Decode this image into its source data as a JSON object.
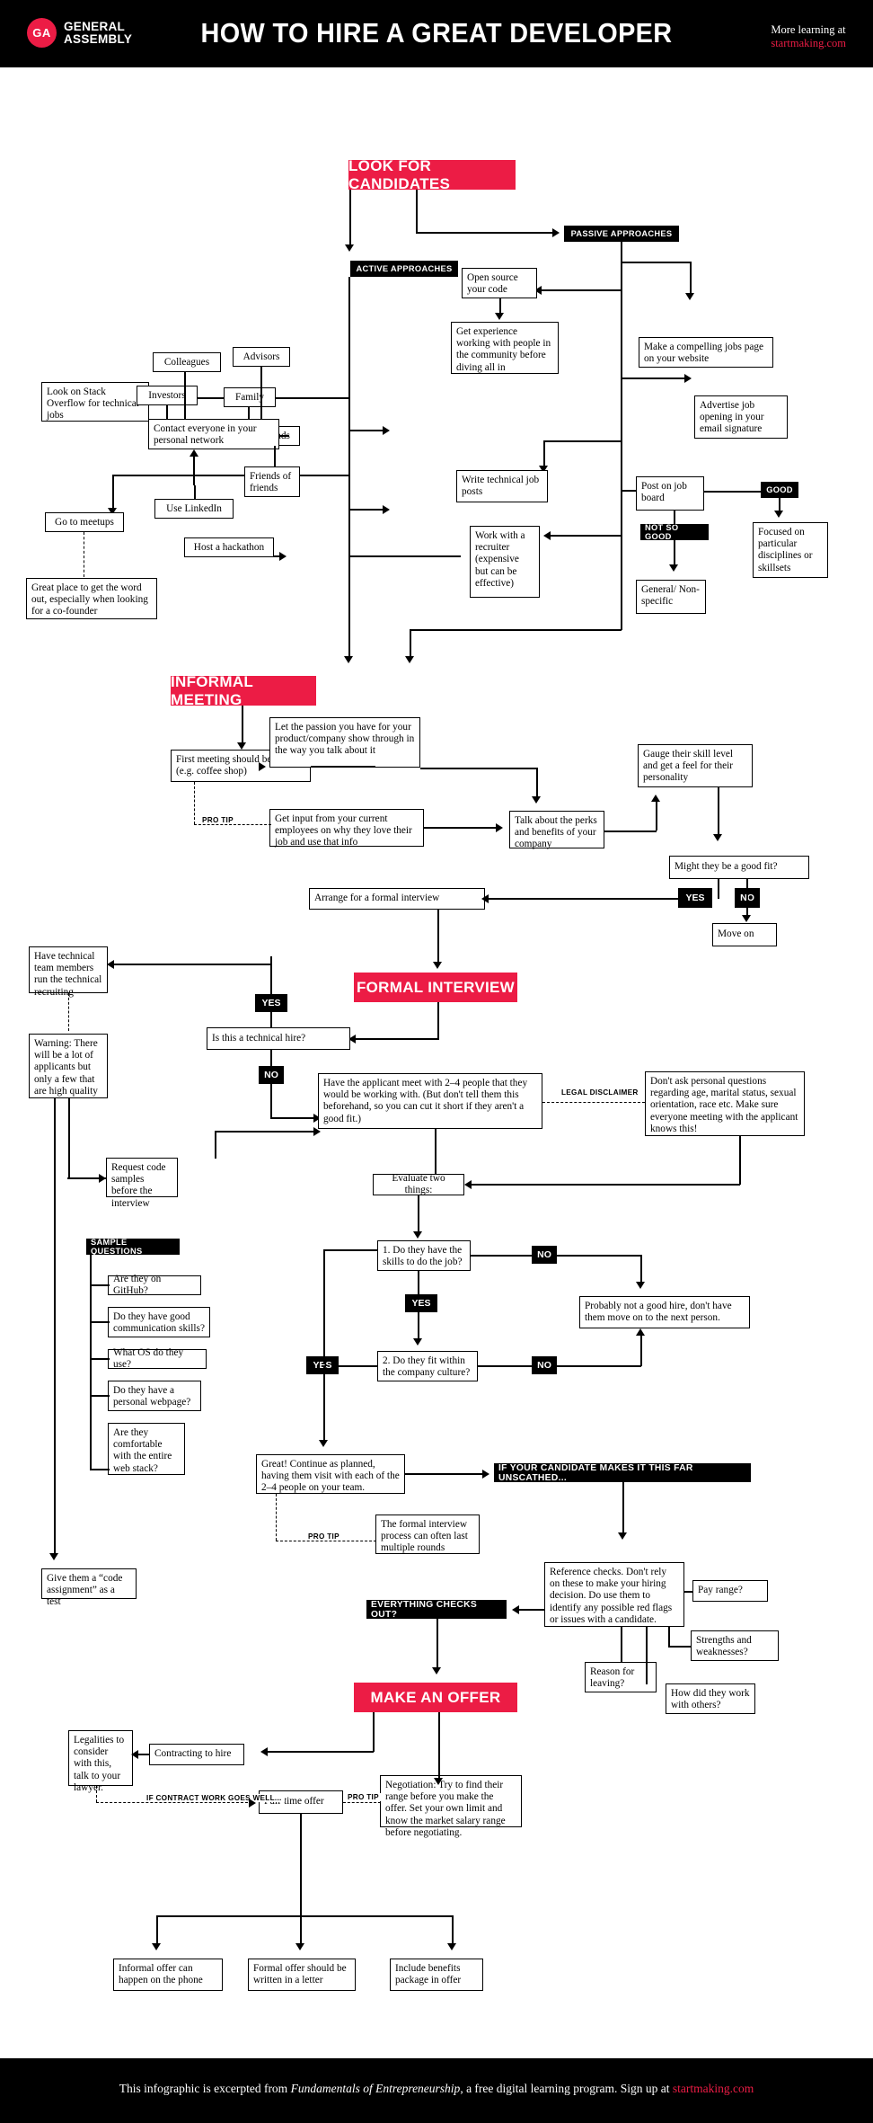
{
  "header": {
    "logo_initials": "GA",
    "logo_line1": "GENERAL",
    "logo_line2": "ASSEMBLY",
    "title": "HOW TO HIRE A GREAT DEVELOPER",
    "more_learning_label": "More learning at",
    "more_learning_url": "startmaking.com",
    "brand_red": "#ec1c45"
  },
  "footer": {
    "text_before": "This infographic is excerpted from ",
    "italic": "Fundamentals of Entrepreneurship",
    "text_after": ", a free digital learning program. Sign up at ",
    "url": "startmaking.com"
  },
  "stages": {
    "look_for_candidates": "LOOK FOR CANDIDATES",
    "informal_meeting": "INFORMAL MEETING",
    "formal_interview": "FORMAL INTERVIEW",
    "make_an_offer": "MAKE AN OFFER"
  },
  "section1": {
    "active_approaches": "ACTIVE APPROACHES",
    "passive_approaches": "PASSIVE APPROACHES",
    "stack_overflow": "Look on Stack Overflow for technical jobs",
    "colleagues": "Colleagues",
    "investors": "Investors",
    "advisors": "Advisors",
    "family": "Family",
    "friends": "Friends",
    "friends_of_friends": "Friends of friends",
    "contact_network": "Contact everyone in your personal network",
    "use_linkedin": "Use LinkedIn",
    "go_to_meetups": "Go to meetups",
    "meetups_note": "Great place to get the word out, especially when looking for a co-founder",
    "host_hackathon": "Host a hackathon",
    "open_source": "Open source your code",
    "get_experience": "Get experience working with people in the community before diving all in",
    "write_job_posts": "Write technical job posts",
    "work_with_recruiter": "Work with a recruiter (expensive but can be effective)",
    "jobs_page": "Make a compelling jobs page on your website",
    "email_signature": "Advertise job opening in your email signature",
    "post_job_board": "Post on job board",
    "good": "GOOD",
    "not_so_good": "NOT SO GOOD",
    "focused": "Focused on particular disciplines or skillsets",
    "general": "General/ Non-specific"
  },
  "section2": {
    "first_meeting": "First meeting should be casual (e.g. coffee shop)",
    "pro_tip": "PRO TIP",
    "get_input": "Get input from your current employees on why they love their job and use that info",
    "passion": "Let the passion you have for your product/company show through in the way you talk about it",
    "perks": "Talk about the perks and benefits of your company",
    "gauge_skill": "Gauge their skill level and get a feel for their personality",
    "good_fit": "Might they be a good fit?",
    "yes": "YES",
    "no": "NO",
    "arrange_interview": "Arrange for a formal interview",
    "move_on": "Move on"
  },
  "section3": {
    "technical_hire": "Is this a technical hire?",
    "yes": "YES",
    "no": "NO",
    "tech_team": "Have technical team members run the  technical recruiting",
    "warning": "Warning: There will be a lot of applicants but only a few that are high quality",
    "request_code": "Request code samples before the interview",
    "code_assignment": "Give them a “code assignment” as a test",
    "applicant_meet": "Have the applicant meet with 2–4 people that they would be working with. (But don't tell them this beforehand, so you can cut it short if they aren't a good fit.)",
    "legal_disclaimer_label": "LEGAL DISCLAIMER",
    "legal_disclaimer": "Don't ask personal questions regarding age, marital status, sexual orientation, race etc. Make sure everyone meeting with the applicant knows this!",
    "evaluate": "Evaluate two things:",
    "sample_questions_label": "SAMPLE QUESTIONS",
    "sample_questions": [
      "Are they on GitHub?",
      "Do they have good communication skills?",
      "What OS do they use?",
      "Do they have a personal webpage?",
      "Are they comfortable with the entire web stack?"
    ],
    "q1": "1. Do they have the skills to do the job?",
    "q2": "2. Do they fit within the company culture?",
    "not_good_hire": "Probably not a good hire, don't have them move on to the next person.",
    "great_continue": "Great! Continue as planned, having them visit with each of the 2–4 people on your team.",
    "pro_tip": "PRO TIP",
    "multiple_rounds": "The formal interview process can often last multiple rounds",
    "unscathed": "IF YOUR CANDIDATE MAKES IT THIS FAR UNSCATHED...",
    "reference_checks": "Reference checks. Don't rely on these to make your hiring decision. Do use them to identify any possible red flags or issues with a candidate.",
    "pay_range": "Pay range?",
    "strengths": "Strengths and weaknesses?",
    "reason_leaving": "Reason for leaving?",
    "work_others": "How did they work with others?",
    "everything_checks_out": "EVERYTHING CHECKS OUT?"
  },
  "section4": {
    "contracting": "Contracting to hire",
    "legalities": "Legalities to consider with this, talk to your lawyer.",
    "contract_goes_well": "IF CONTRACT WORK GOES WELL...",
    "full_time_offer": "Full-time offer",
    "pro_tip": "PRO TIP",
    "negotiation": "Negotiation: Try to find their range before you make the offer. Set your own limit and know the market salary range before negotiating.",
    "informal_offer": "Informal offer can happen on the phone",
    "formal_offer": "Formal offer should be written in a letter",
    "benefits": "Include benefits package in offer"
  }
}
